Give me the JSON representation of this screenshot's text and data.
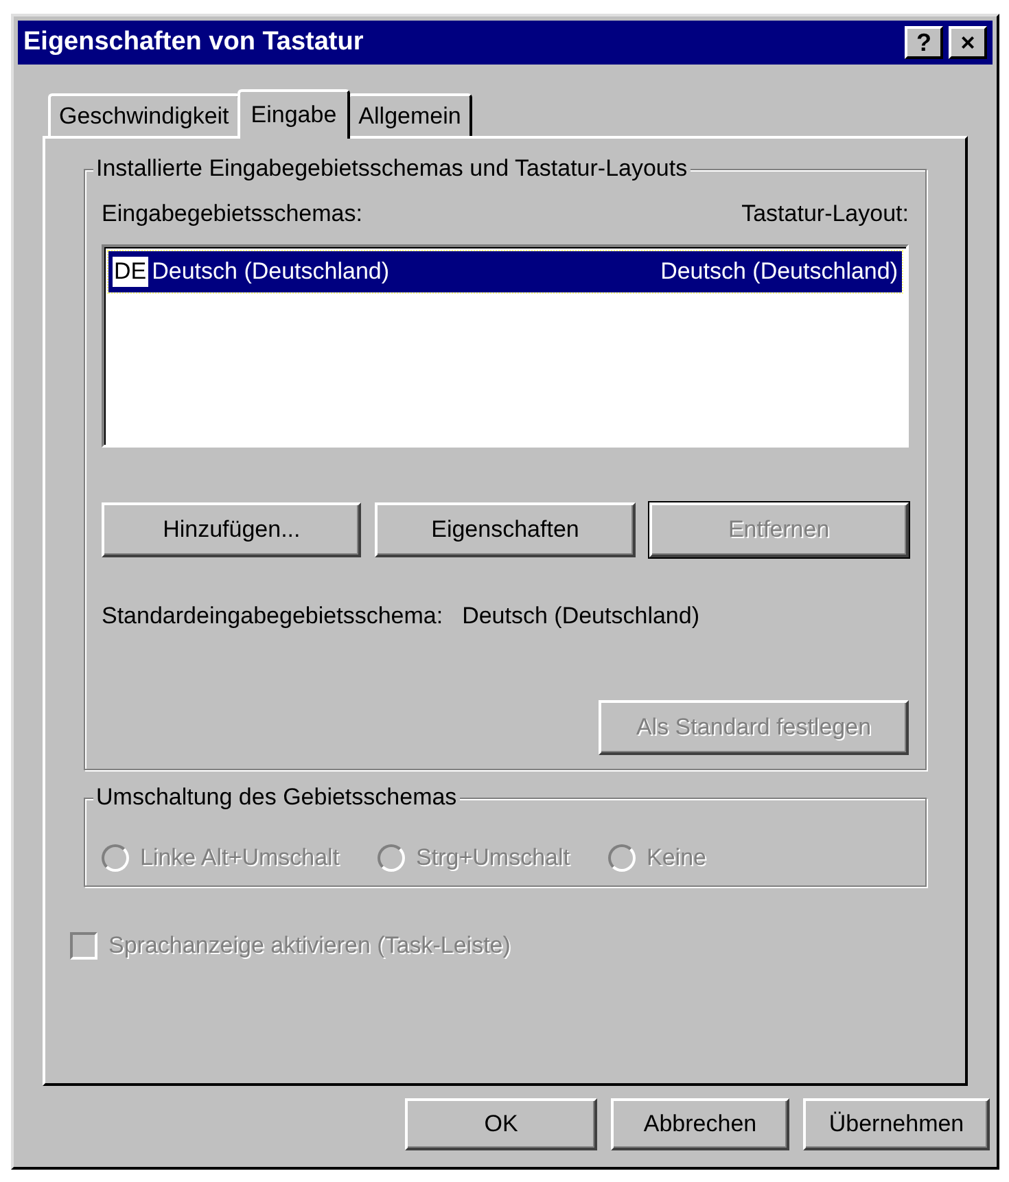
{
  "window": {
    "title": "Eigenschaften von Tastatur",
    "title_buttons": [
      "?",
      "×"
    ]
  },
  "tabs": [
    {
      "label": "Geschwindigkeit",
      "selected": false
    },
    {
      "label": "Eingabe",
      "selected": true
    },
    {
      "label": "Allgemein",
      "selected": false
    }
  ],
  "locales_group": {
    "title": "Installierte Eingabegebietsschemas und Tastatur-Layouts",
    "columns": [
      "Eingabegebietsschemas:",
      "Tastatur-Layout:"
    ],
    "rows": [
      {
        "badge": "DE",
        "locale": "Deutsch (Deutschland)",
        "layout": "Deutsch (Deutschland)",
        "selected": true
      }
    ],
    "buttons": [
      {
        "label": "Hinzufügen...",
        "disabled": false,
        "default": false
      },
      {
        "label": "Eigenschaften",
        "disabled": false,
        "default": false
      },
      {
        "label": "Entfernen",
        "disabled": true,
        "default": true
      }
    ],
    "default_label": "Standardeingabegebietsschema:",
    "default_value": "Deutsch (Deutschland)",
    "set_default_button": {
      "label": "Als Standard festlegen",
      "disabled": true
    }
  },
  "switch_group": {
    "title": "Umschaltung des Gebietsschemas",
    "options": [
      {
        "label": "Linke Alt+Umschalt",
        "selected": false,
        "disabled": true
      },
      {
        "label": "Strg+Umschalt",
        "selected": false,
        "disabled": true
      },
      {
        "label": "Keine",
        "selected": false,
        "disabled": true
      }
    ]
  },
  "language_indicator": {
    "label": "Sprachanzeige aktivieren (Task-Leiste)",
    "checked": false,
    "disabled": true
  },
  "dialog_buttons": [
    {
      "label": "OK",
      "disabled": false
    },
    {
      "label": "Abbrechen",
      "disabled": false
    },
    {
      "label": "Übernehmen",
      "disabled": false
    }
  ]
}
